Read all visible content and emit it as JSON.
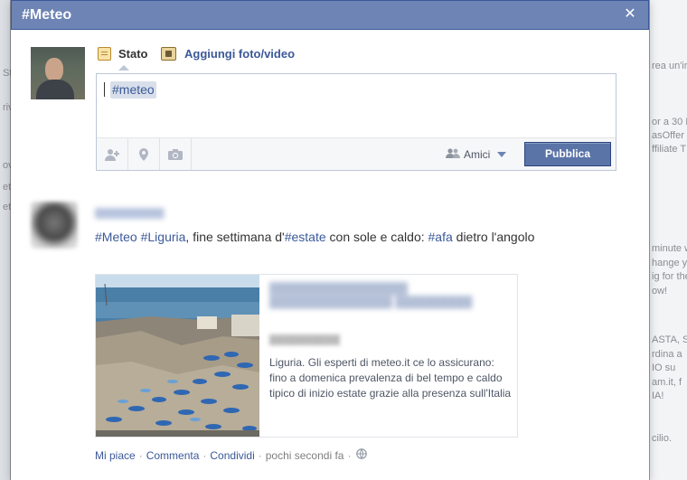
{
  "dialog": {
    "title": "#Meteo",
    "close_icon": "close-icon"
  },
  "composer": {
    "tabs": [
      {
        "label": "Stato",
        "icon": "status-icon"
      },
      {
        "label": "Aggiungi foto/video",
        "icon": "photo-icon"
      }
    ],
    "input_value": "#meteo",
    "toolbar_icons": [
      "tag-friends-icon",
      "location-pin-icon",
      "camera-icon"
    ],
    "audience_label": "Amici",
    "publish_label": "Pubblica"
  },
  "post": {
    "text_parts": [
      {
        "text": "#Meteo",
        "tag": true
      },
      {
        "text": " ",
        "tag": false
      },
      {
        "text": "#Liguria",
        "tag": true
      },
      {
        "text": ", fine settimana d'",
        "tag": false
      },
      {
        "text": "#estate",
        "tag": true
      },
      {
        "text": " con sole e caldo: ",
        "tag": false
      },
      {
        "text": "#afa",
        "tag": true
      },
      {
        "text": " dietro l'angolo",
        "tag": false
      }
    ],
    "share": {
      "description": "Liguria. Gli esperti di meteo.it ce lo assicurano: fino a domenica prevalenza di bel tempo e caldo tipico di inizio estate grazie alla presenza sull'Italia"
    },
    "actions": {
      "like": "Mi piace",
      "comment": "Commenta",
      "share": "Condividi",
      "timestamp": "pochi secondi fa",
      "privacy_icon": "globe-icon"
    }
  },
  "background": {
    "left_snips": [
      "St",
      "rivi",
      "ov",
      "ete",
      "ett"
    ],
    "right_snips": [
      "rea un'ir",
      "or a 30 I",
      "asOffer",
      "ffiliate T",
      "minute w",
      "hange y",
      "ig for the",
      "ow!",
      "ASTA, S",
      "rdina a",
      "IO su",
      "am.it, f",
      "IA!",
      "cilio."
    ]
  }
}
